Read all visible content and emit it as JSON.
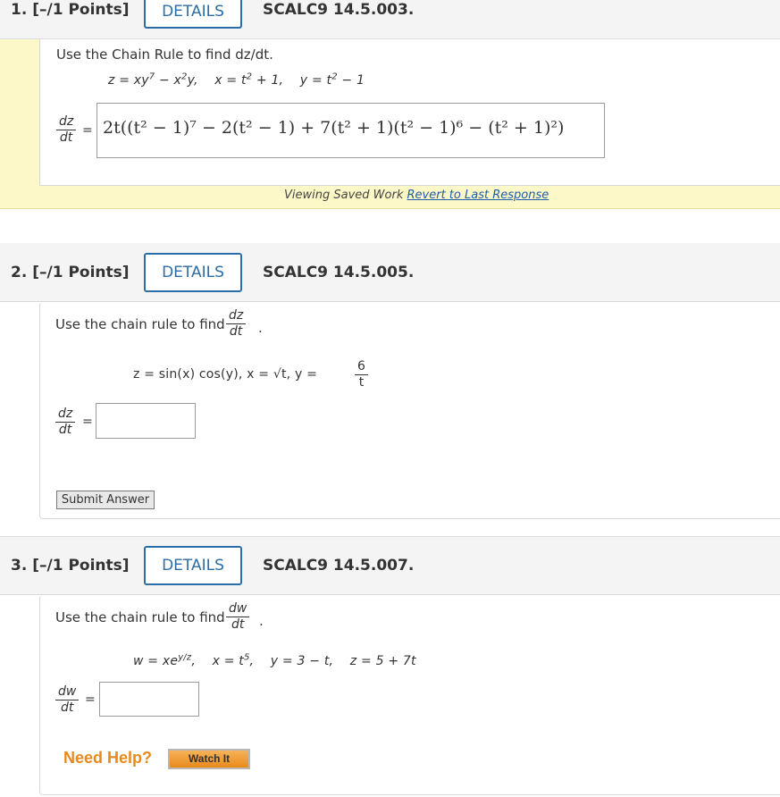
{
  "questions": [
    {
      "number": "1.",
      "points": "[–/1 Points]",
      "details_label": "DETAILS",
      "code": "SCALC9 14.5.003.",
      "prompt": "Use the Chain Rule to find dz/dt.",
      "equation": "z = xy7 − x2y,   x = t2 + 1,   y = t2 − 1",
      "lhs_num": "dz",
      "lhs_den": "dt",
      "equals": "=",
      "answer": "2t((t² − 1)⁷ − 2(t² − 1) + 7(t² + 1)(t² − 1)⁶ − (t² + 1)²)",
      "saved_note": "Viewing Saved Work",
      "revert_link": "Revert to Last Response"
    },
    {
      "number": "2.",
      "points": "[–/1 Points]",
      "details_label": "DETAILS",
      "code": "SCALC9 14.5.005.",
      "prompt": "Use the chain rule to find",
      "prompt_num": "dz",
      "prompt_den": "dt",
      "equation_left": "z = sin(x) cos(y),   x = √t,   y =",
      "y_num": "6",
      "y_den": "t",
      "lhs_num": "dz",
      "lhs_den": "dt",
      "equals": "=",
      "answer_value": "",
      "submit_label": "Submit Answer"
    },
    {
      "number": "3.",
      "points": "[–/1 Points]",
      "details_label": "DETAILS",
      "code": "SCALC9 14.5.007.",
      "prompt": "Use the chain rule to find",
      "prompt_num": "dw",
      "prompt_den": "dt",
      "equation": "w = xey/z,   x = t5,   y = 3 − t,   z = 5 + 7t",
      "lhs_num": "dw",
      "lhs_den": "dt",
      "equals": "=",
      "answer_value": "",
      "help_label": "Need Help?",
      "watch_label": "Watch It"
    }
  ],
  "colors": {
    "details_border": "#2b6da8",
    "saved_bg": "#fdf8c7",
    "help_orange": "#e88a1a",
    "link_blue": "#1f5da8"
  }
}
